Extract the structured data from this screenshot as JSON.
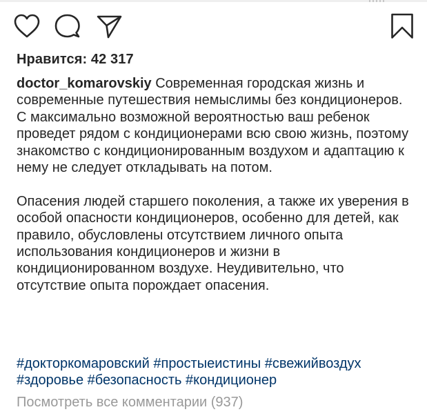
{
  "post": {
    "likes_text": "Нравится: 42 317",
    "author": "doctor_komarovskiy",
    "caption_paragraph_1": "Современная городская жизнь и современные путешествия немыслимы без кондиционеров. С максимально возможной вероятностью ваш ребенок проведет рядом с кондиционерами всю свою жизнь, поэтому знакомство с кондиционированным воздухом и адаптацию к нему не следует откладывать на потом.",
    "caption_paragraph_2": "Опасения людей старшего поколения, а также их уверения в особой опасности кондиционеров, особенно для детей, как правило, обусловлены отсутствием личного опыта использования кондиционеров и жизни в кондиционированном воздухе. Неудивительно, что отсутствие опыта порождает опасения.",
    "hashtags": [
      "#докторкомаровский",
      "#простыеистины",
      "#свежийвоздух",
      "#здоровье",
      "#безопасность",
      "#кондиционер"
    ],
    "view_comments": "Посмотреть все комментарии (937)"
  },
  "actions": {
    "icons": [
      "heart-icon",
      "comment-bubble-icon",
      "paper-plane-icon",
      "bookmark-icon"
    ]
  },
  "colors": {
    "text": "#262626",
    "hashtag": "#003569",
    "muted": "#999999",
    "background": "#ffffff"
  }
}
